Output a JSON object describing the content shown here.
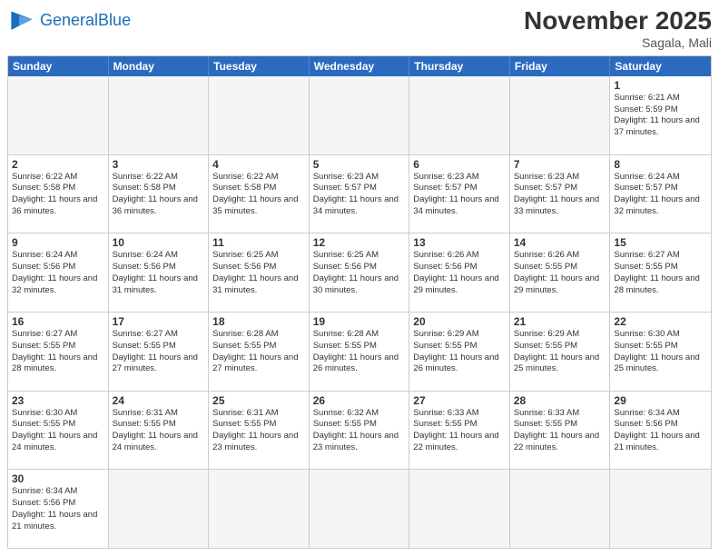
{
  "header": {
    "logo_general": "General",
    "logo_blue": "Blue",
    "month_title": "November 2025",
    "location": "Sagala, Mali"
  },
  "days_of_week": [
    "Sunday",
    "Monday",
    "Tuesday",
    "Wednesday",
    "Thursday",
    "Friday",
    "Saturday"
  ],
  "weeks": [
    [
      {
        "day": "",
        "info": ""
      },
      {
        "day": "",
        "info": ""
      },
      {
        "day": "",
        "info": ""
      },
      {
        "day": "",
        "info": ""
      },
      {
        "day": "",
        "info": ""
      },
      {
        "day": "",
        "info": ""
      },
      {
        "day": "1",
        "info": "Sunrise: 6:21 AM\nSunset: 5:59 PM\nDaylight: 11 hours and 37 minutes."
      }
    ],
    [
      {
        "day": "2",
        "info": "Sunrise: 6:22 AM\nSunset: 5:58 PM\nDaylight: 11 hours and 36 minutes."
      },
      {
        "day": "3",
        "info": "Sunrise: 6:22 AM\nSunset: 5:58 PM\nDaylight: 11 hours and 36 minutes."
      },
      {
        "day": "4",
        "info": "Sunrise: 6:22 AM\nSunset: 5:58 PM\nDaylight: 11 hours and 35 minutes."
      },
      {
        "day": "5",
        "info": "Sunrise: 6:23 AM\nSunset: 5:57 PM\nDaylight: 11 hours and 34 minutes."
      },
      {
        "day": "6",
        "info": "Sunrise: 6:23 AM\nSunset: 5:57 PM\nDaylight: 11 hours and 34 minutes."
      },
      {
        "day": "7",
        "info": "Sunrise: 6:23 AM\nSunset: 5:57 PM\nDaylight: 11 hours and 33 minutes."
      },
      {
        "day": "8",
        "info": "Sunrise: 6:24 AM\nSunset: 5:57 PM\nDaylight: 11 hours and 32 minutes."
      }
    ],
    [
      {
        "day": "9",
        "info": "Sunrise: 6:24 AM\nSunset: 5:56 PM\nDaylight: 11 hours and 32 minutes."
      },
      {
        "day": "10",
        "info": "Sunrise: 6:24 AM\nSunset: 5:56 PM\nDaylight: 11 hours and 31 minutes."
      },
      {
        "day": "11",
        "info": "Sunrise: 6:25 AM\nSunset: 5:56 PM\nDaylight: 11 hours and 31 minutes."
      },
      {
        "day": "12",
        "info": "Sunrise: 6:25 AM\nSunset: 5:56 PM\nDaylight: 11 hours and 30 minutes."
      },
      {
        "day": "13",
        "info": "Sunrise: 6:26 AM\nSunset: 5:56 PM\nDaylight: 11 hours and 29 minutes."
      },
      {
        "day": "14",
        "info": "Sunrise: 6:26 AM\nSunset: 5:55 PM\nDaylight: 11 hours and 29 minutes."
      },
      {
        "day": "15",
        "info": "Sunrise: 6:27 AM\nSunset: 5:55 PM\nDaylight: 11 hours and 28 minutes."
      }
    ],
    [
      {
        "day": "16",
        "info": "Sunrise: 6:27 AM\nSunset: 5:55 PM\nDaylight: 11 hours and 28 minutes."
      },
      {
        "day": "17",
        "info": "Sunrise: 6:27 AM\nSunset: 5:55 PM\nDaylight: 11 hours and 27 minutes."
      },
      {
        "day": "18",
        "info": "Sunrise: 6:28 AM\nSunset: 5:55 PM\nDaylight: 11 hours and 27 minutes."
      },
      {
        "day": "19",
        "info": "Sunrise: 6:28 AM\nSunset: 5:55 PM\nDaylight: 11 hours and 26 minutes."
      },
      {
        "day": "20",
        "info": "Sunrise: 6:29 AM\nSunset: 5:55 PM\nDaylight: 11 hours and 26 minutes."
      },
      {
        "day": "21",
        "info": "Sunrise: 6:29 AM\nSunset: 5:55 PM\nDaylight: 11 hours and 25 minutes."
      },
      {
        "day": "22",
        "info": "Sunrise: 6:30 AM\nSunset: 5:55 PM\nDaylight: 11 hours and 25 minutes."
      }
    ],
    [
      {
        "day": "23",
        "info": "Sunrise: 6:30 AM\nSunset: 5:55 PM\nDaylight: 11 hours and 24 minutes."
      },
      {
        "day": "24",
        "info": "Sunrise: 6:31 AM\nSunset: 5:55 PM\nDaylight: 11 hours and 24 minutes."
      },
      {
        "day": "25",
        "info": "Sunrise: 6:31 AM\nSunset: 5:55 PM\nDaylight: 11 hours and 23 minutes."
      },
      {
        "day": "26",
        "info": "Sunrise: 6:32 AM\nSunset: 5:55 PM\nDaylight: 11 hours and 23 minutes."
      },
      {
        "day": "27",
        "info": "Sunrise: 6:33 AM\nSunset: 5:55 PM\nDaylight: 11 hours and 22 minutes."
      },
      {
        "day": "28",
        "info": "Sunrise: 6:33 AM\nSunset: 5:55 PM\nDaylight: 11 hours and 22 minutes."
      },
      {
        "day": "29",
        "info": "Sunrise: 6:34 AM\nSunset: 5:56 PM\nDaylight: 11 hours and 21 minutes."
      }
    ],
    [
      {
        "day": "30",
        "info": "Sunrise: 6:34 AM\nSunset: 5:56 PM\nDaylight: 11 hours and 21 minutes."
      },
      {
        "day": "",
        "info": ""
      },
      {
        "day": "",
        "info": ""
      },
      {
        "day": "",
        "info": ""
      },
      {
        "day": "",
        "info": ""
      },
      {
        "day": "",
        "info": ""
      },
      {
        "day": "",
        "info": ""
      }
    ]
  ]
}
